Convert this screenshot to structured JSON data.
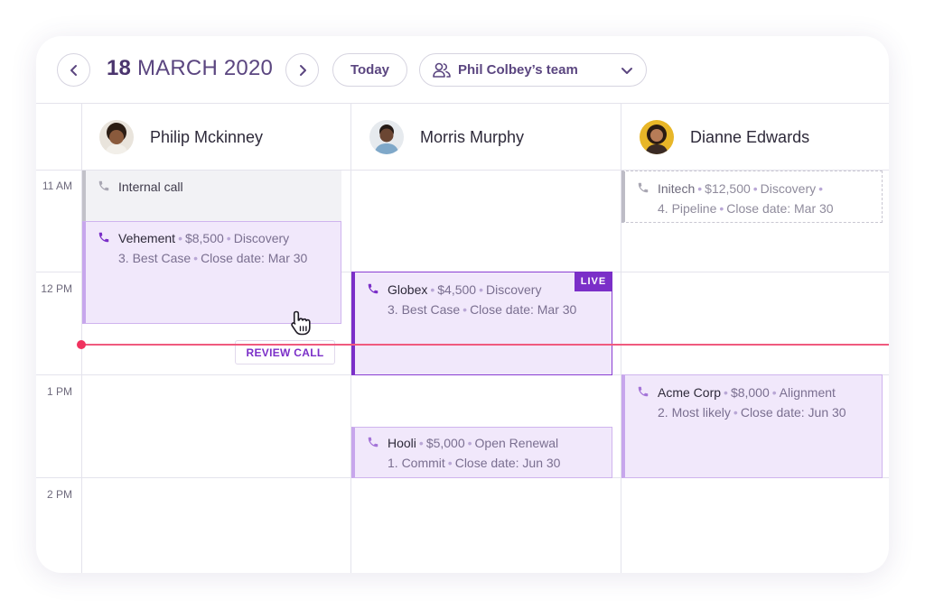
{
  "toolbar": {
    "prev_icon": "chevron-left-icon",
    "next_icon": "chevron-right-icon",
    "date_day": "18",
    "date_rest": "MARCH 2020",
    "today_label": "Today",
    "team_label": "Phil Colbey’s team",
    "team_icon": "users-icon"
  },
  "people": [
    {
      "name": "Philip Mckinney"
    },
    {
      "name": "Morris Murphy"
    },
    {
      "name": "Dianne Edwards"
    }
  ],
  "times": [
    "11 AM",
    "12 PM",
    "1 PM",
    "2 PM"
  ],
  "events": {
    "internal": {
      "title": "Internal call"
    },
    "vehement": {
      "title": "Vehement",
      "amount": "$8,500",
      "stage": "Discovery",
      "forecast": "3. Best Case",
      "close": "Close date: Mar 30",
      "action": "REVIEW CALL"
    },
    "globex": {
      "title": "Globex",
      "amount": "$4,500",
      "stage": "Discovery",
      "forecast": "3. Best Case",
      "close": "Close date: Mar 30",
      "badge": "LIVE"
    },
    "hooli": {
      "title": "Hooli",
      "amount": "$5,000",
      "stage": "Open Renewal",
      "forecast": "1. Commit",
      "close": "Close date: Jun 30"
    },
    "initech": {
      "title": "Initech",
      "amount": "$12,500",
      "stage": "Discovery",
      "forecast": "4. Pipeline",
      "close": "Close date: Mar 30"
    },
    "acme": {
      "title": "Acme Corp",
      "amount": "$8,000",
      "stage": "Alignment",
      "forecast": "2. Most likely",
      "close": "Close date: Jun 30"
    }
  },
  "colors": {
    "accent": "#7b2fc8",
    "now_line": "#f05a7e",
    "event_bg": "#f1e8fb"
  }
}
